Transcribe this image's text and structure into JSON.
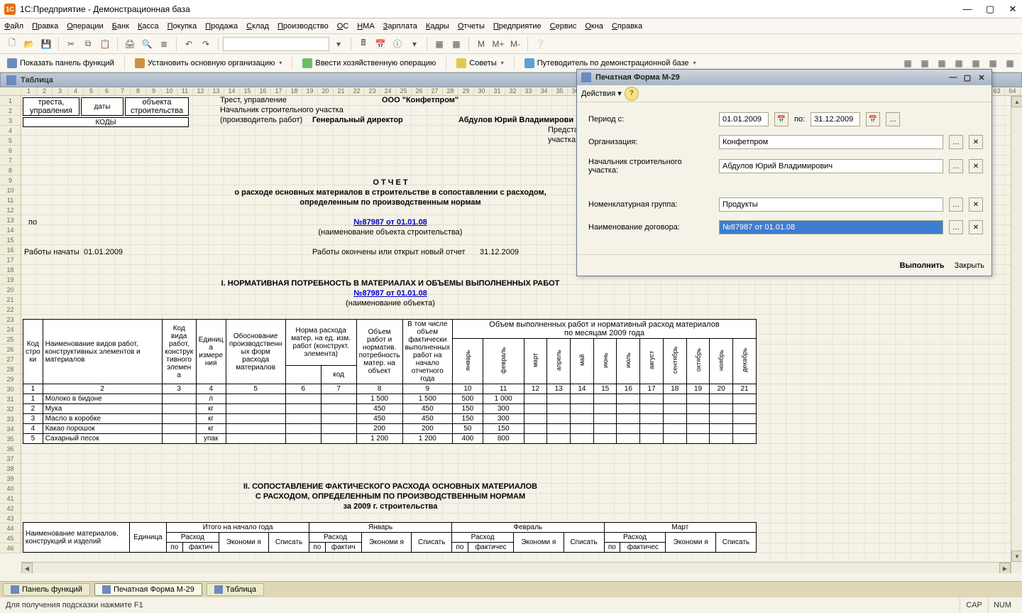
{
  "window": {
    "title": "1С:Предприятие - Демонстрационная база"
  },
  "menu": [
    "Файл",
    "Правка",
    "Операции",
    "Банк",
    "Касса",
    "Покупка",
    "Продажа",
    "Склад",
    "Производство",
    "ОС",
    "НМА",
    "Зарплата",
    "Кадры",
    "Отчеты",
    "Предприятие",
    "Сервис",
    "Окна",
    "Справка"
  ],
  "toolbar2": {
    "panel": "Показать панель функций",
    "org": "Установить основную организацию",
    "oper": "Ввести хозяйственную операцию",
    "tips": "Советы",
    "guide": "Путеводитель по демонстрационной базе"
  },
  "doc_tab": {
    "title": "Таблица"
  },
  "header": {
    "c1a": "треста,",
    "c1b": "управления",
    "c2": "даты",
    "c3a": "объекта",
    "c3b": "строительства",
    "codes": "КОДЫ",
    "trust": "Трест, управление",
    "ooo": "ООО \"Конфетпром\"",
    "chief": "Начальник строительного участка",
    "role": "(производитель работ)",
    "gd": "Генеральный директор",
    "fio": "Абдулов Юрий Владимирови",
    "pred": "Предста",
    "uch": "участка (п"
  },
  "report": {
    "t1": "О Т Ч Е Т",
    "t2": "о расходе основных материалов в строительстве в сопоставлении с расходом,",
    "t3": "определенным по производственным нормам",
    "po": "по",
    "contract": "№87987 от 01.01.08",
    "obj_name": "(наименование объекта строительства)",
    "start_lbl": "Работы начаты",
    "start": "01.01.2009",
    "end_lbl": "Работы окончены или открыт новый отчет",
    "end": "31.12.2009"
  },
  "section1": {
    "title": "I. НОРМАТИВНАЯ ПОТРЕБНОСТЬ В МАТЕРИАЛАХ И ОБЪЕМЫ ВЫПОЛНЕННЫХ РАБОТ",
    "contract": "№87987 от 01.01.08",
    "obj": "(наименование объекта)",
    "h_code": "Код стро ки",
    "h_name": "Наименование видов работ, конструктивных элементов и материалов",
    "h_kind": "Код вида работ, конструк тивного элемен а",
    "h_unit": "Единиц а измере ния",
    "h_basis": "Обоснование производственн ых форм расхода материалов",
    "h_rate": "Норма расхода матер. на ед. изм. работ (конструкт. элемента)",
    "h_rate_code": "код",
    "h_vol": "Объем работ и норматив. потребность матер. на объект",
    "h_fact": "В том числе объем фактически выполненных работ на начало отчетного года",
    "h_months": "Объем выполненных работ и нормативный расход материалов",
    "h_months2": "по месяцам  2009   года",
    "months": [
      "январь",
      "февраль",
      "март",
      "апрель",
      "май",
      "июнь",
      "июль",
      "август",
      "сентябрь",
      "октябрь",
      "ноябрь",
      "декабрь"
    ],
    "num_row": [
      "1",
      "2",
      "3",
      "4",
      "5",
      "6",
      "7",
      "8",
      "9",
      "10",
      "11",
      "12",
      "13",
      "14",
      "15",
      "16",
      "17",
      "18",
      "19",
      "20",
      "21"
    ]
  },
  "chart_data": {
    "type": "table",
    "columns": [
      "Код строки",
      "Наименование",
      "Ед.",
      "Объем",
      "В т.ч. факт",
      "январь",
      "февраль"
    ],
    "rows": [
      {
        "n": 1,
        "name": "Молоко в бидоне",
        "unit": "л",
        "vol": 1500,
        "fact": 1500,
        "m1": 500,
        "m2": 1000
      },
      {
        "n": 2,
        "name": "Мука",
        "unit": "кг",
        "vol": 450,
        "fact": 450,
        "m1": 150,
        "m2": 300
      },
      {
        "n": 3,
        "name": "Масло в коробке",
        "unit": "кг",
        "vol": 450,
        "fact": 450,
        "m1": 150,
        "m2": 300
      },
      {
        "n": 4,
        "name": "Какао порошок",
        "unit": "кг",
        "vol": 200,
        "fact": 200,
        "m1": 50,
        "m2": 150
      },
      {
        "n": 5,
        "name": "Сахарный песок",
        "unit": "упак",
        "vol": 1200,
        "fact": 1200,
        "m1": 400,
        "m2": 800
      }
    ]
  },
  "section2": {
    "title": "II. СОПОСТАВЛЕНИЕ ФАКТИЧЕСКОГО РАСХОДА ОСНОВНЫХ МАТЕРИАЛОВ",
    "sub": "С РАСХОДОМ, ОПРЕДЕЛЕННЫМ ПО ПРОИЗВОДСТВЕННЫМ НОРМАМ",
    "period": "за   2009       г. строительства",
    "h_name": "Наименование материалов, конструкций и изделий",
    "h_unit": "Единица",
    "h_begin": "Итого на начало года",
    "h_rate": "Расход",
    "h_po": "по",
    "h_fact": "фактич",
    "h_econ": "Экономи я",
    "h_write": "Списать",
    "months": [
      "Январь",
      "Февраль",
      "Март"
    ]
  },
  "dialog": {
    "title": "Печатная Форма М-29",
    "actions": "Действия",
    "period_lbl": "Период с:",
    "from": "01.01.2009",
    "to_lbl": "по:",
    "to": "31.12.2009",
    "org_lbl": "Организация:",
    "org": "Конфетпром",
    "chief_lbl": "Начальник строительного участка:",
    "chief": "Абдулов Юрий Владимирович",
    "group_lbl": "Номенклатурная группа:",
    "group": "Продукты",
    "contract_lbl": "Наименование договора:",
    "contract": "№87987 от 01.01.08",
    "ok": "Выполнить",
    "close": "Закрыть"
  },
  "taskbar": {
    "t1": "Панель функций",
    "t2": "Печатная Форма М-29",
    "t3": "Таблица"
  },
  "status": {
    "hint": "Для получения подсказки нажмите F1",
    "cap": "CAP",
    "num": "NUM"
  }
}
